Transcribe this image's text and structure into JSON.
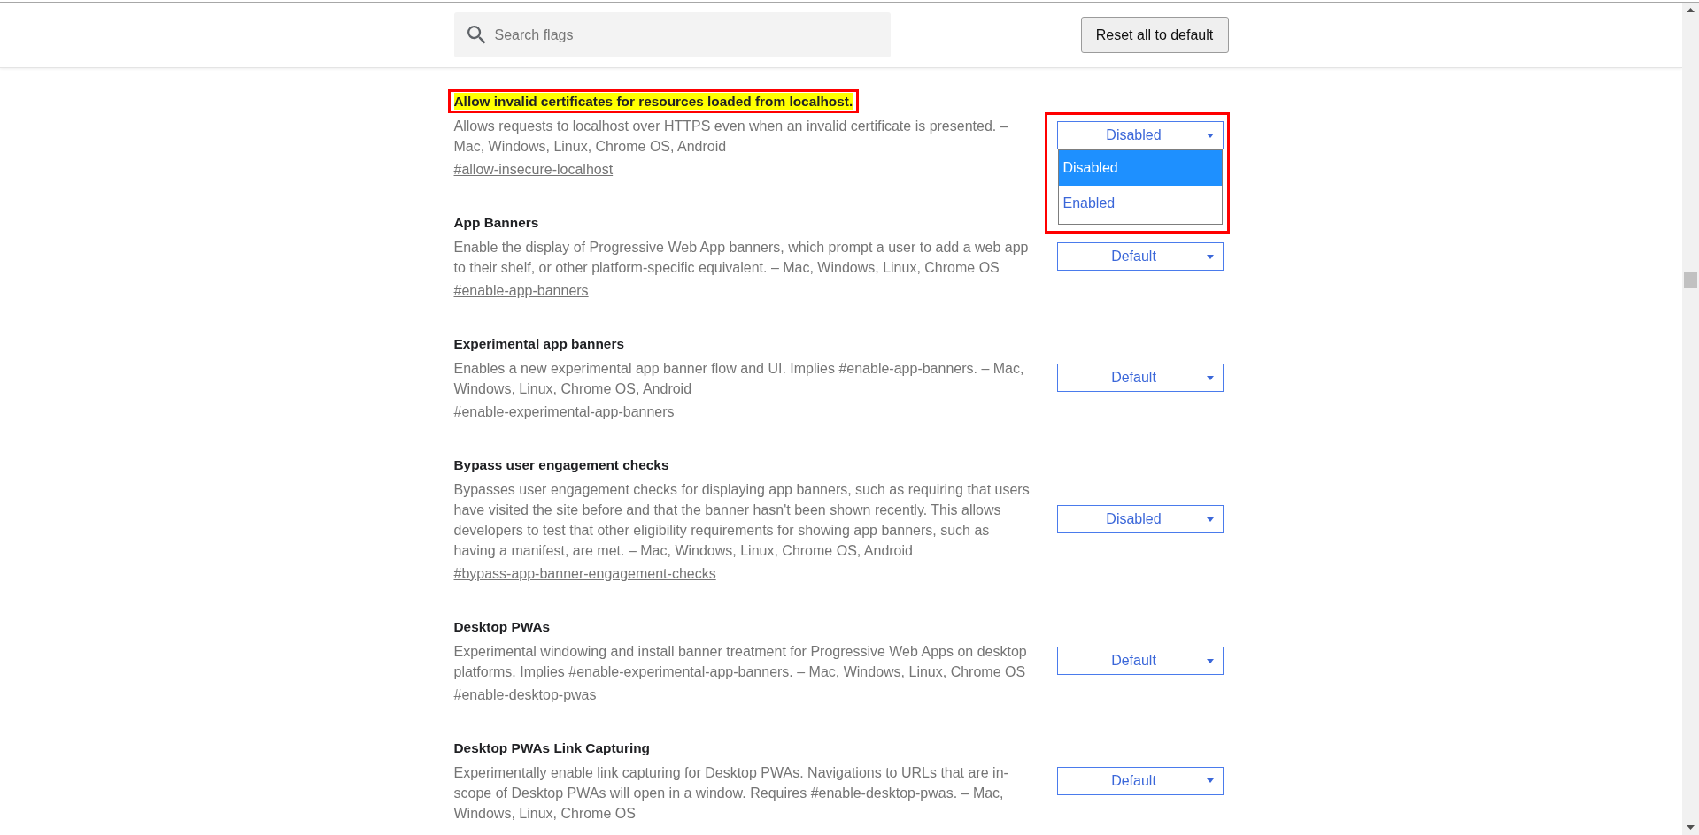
{
  "header": {
    "search": {
      "placeholder": "Search flags"
    },
    "reset_button": "Reset all to default"
  },
  "flags": [
    {
      "title": "Allow invalid certificates for resources loaded from localhost.",
      "highlighted": true,
      "description": "Allows requests to localhost over HTTPS even when an invalid certificate is presented. – Mac, Windows, Linux, Chrome OS, Android",
      "link": "#allow-insecure-localhost",
      "select": {
        "value": "Disabled",
        "open": true,
        "options": [
          {
            "label": "Disabled",
            "selected": true
          },
          {
            "label": "Enabled",
            "selected": false
          }
        ]
      }
    },
    {
      "title": "App Banners",
      "highlighted": false,
      "description": "Enable the display of Progressive Web App banners, which prompt a user to add a web app to their shelf, or other platform-specific equivalent. – Mac, Windows, Linux, Chrome OS",
      "link": "#enable-app-banners",
      "select": {
        "value": "Default"
      }
    },
    {
      "title": "Experimental app banners",
      "highlighted": false,
      "description": "Enables a new experimental app banner flow and UI. Implies #enable-app-banners. – Mac, Windows, Linux, Chrome OS, Android",
      "link": "#enable-experimental-app-banners",
      "select": {
        "value": "Default"
      }
    },
    {
      "title": "Bypass user engagement checks",
      "highlighted": false,
      "description": "Bypasses user engagement checks for displaying app banners, such as requiring that users have visited the site before and that the banner hasn't been shown recently. This allows developers to test that other eligibility requirements for showing app banners, such as having a manifest, are met. – Mac, Windows, Linux, Chrome OS, Android",
      "link": "#bypass-app-banner-engagement-checks",
      "select": {
        "value": "Disabled"
      }
    },
    {
      "title": "Desktop PWAs",
      "highlighted": false,
      "description": "Experimental windowing and install banner treatment for Progressive Web Apps on desktop platforms. Implies #enable-experimental-app-banners. – Mac, Windows, Linux, Chrome OS",
      "link": "#enable-desktop-pwas",
      "select": {
        "value": "Default"
      }
    },
    {
      "title": "Desktop PWAs Link Capturing",
      "highlighted": false,
      "description": "Experimentally enable link capturing for Desktop PWAs. Navigations to URLs that are in-scope of Desktop PWAs will open in a window. Requires #enable-desktop-pwas. – Mac, Windows, Linux, Chrome OS",
      "select": {
        "value": "Default"
      }
    }
  ]
}
